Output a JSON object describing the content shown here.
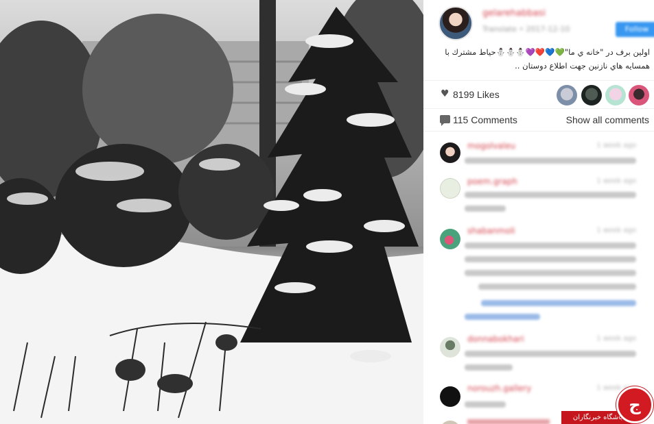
{
  "post": {
    "username": "gelarehabbasi",
    "subline": "Translate • 2017-12-10",
    "follow_label": "Follow",
    "caption_line1": "اولين برف در \"خانه ي ما\"💚💙❤️💜⛄⛄⛄حياط مشترك با",
    "caption_line2": "همسايه هاي نازنين جهت اطلاع دوستان .."
  },
  "stats": {
    "likes": "8199 Likes",
    "comments": "115 Comments",
    "show_all": "Show all comments"
  },
  "comments": [
    {
      "name": "mogolvaleu",
      "time": "1 week ago"
    },
    {
      "name": "poem.graph",
      "time": "1 week ago"
    },
    {
      "name": "shabanmoli",
      "time": "1 week ago"
    },
    {
      "name": "donnabokhari",
      "time": "1 week ago"
    },
    {
      "name": "norouzh.gallery",
      "time": "1 week ago"
    }
  ],
  "watermark": {
    "badge_text": "باشگاه خبرنگاران",
    "badge_letter": "ج"
  },
  "colors": {
    "username": "#d4444e",
    "follow": "#3897f0",
    "badge": "#c4161c"
  }
}
